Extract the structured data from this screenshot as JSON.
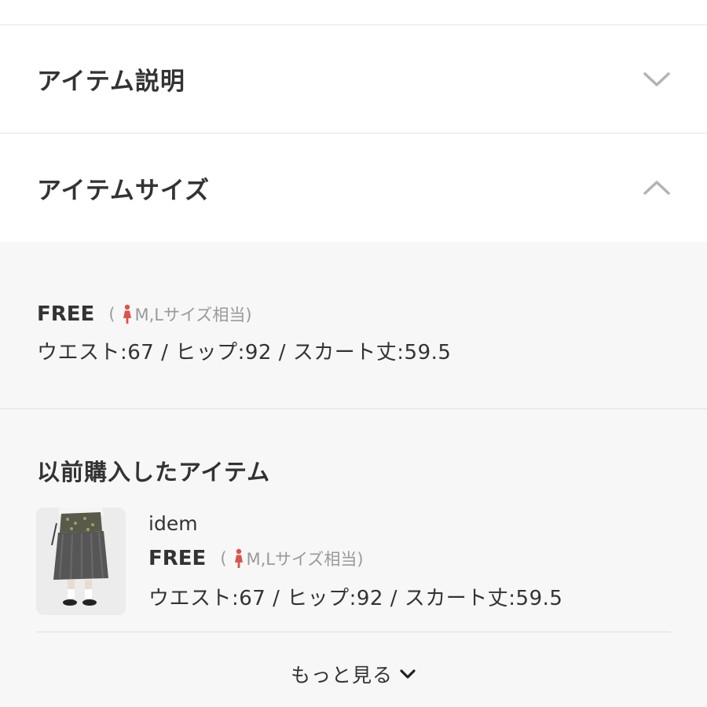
{
  "accordion": {
    "description_title": "アイテム説明",
    "size_title": "アイテムサイズ"
  },
  "size_panel": {
    "size_name": "FREE",
    "note_open": "(",
    "note_text": "M,Lサイズ相当)",
    "measurements": "ウエスト:67 / ヒップ:92 / スカート丈:59.5"
  },
  "previous": {
    "title": "以前購入したアイテム",
    "item": {
      "brand": "idem",
      "size_name": "FREE",
      "note_open": "(",
      "note_text": "M,Lサイズ相当)",
      "measurements": "ウエスト:67 / ヒップ:92 / スカート丈:59.5"
    }
  },
  "more": {
    "label": "もっと見る"
  },
  "icons": {
    "description_chevron": "chevron-down-icon",
    "size_chevron": "chevron-up-icon",
    "person": "woman-icon",
    "more_chevron": "chevron-down-icon"
  },
  "colors": {
    "person_icon": "#d9534f",
    "muted_text": "#9a9a9a",
    "panel_bg": "#f7f7f7"
  }
}
